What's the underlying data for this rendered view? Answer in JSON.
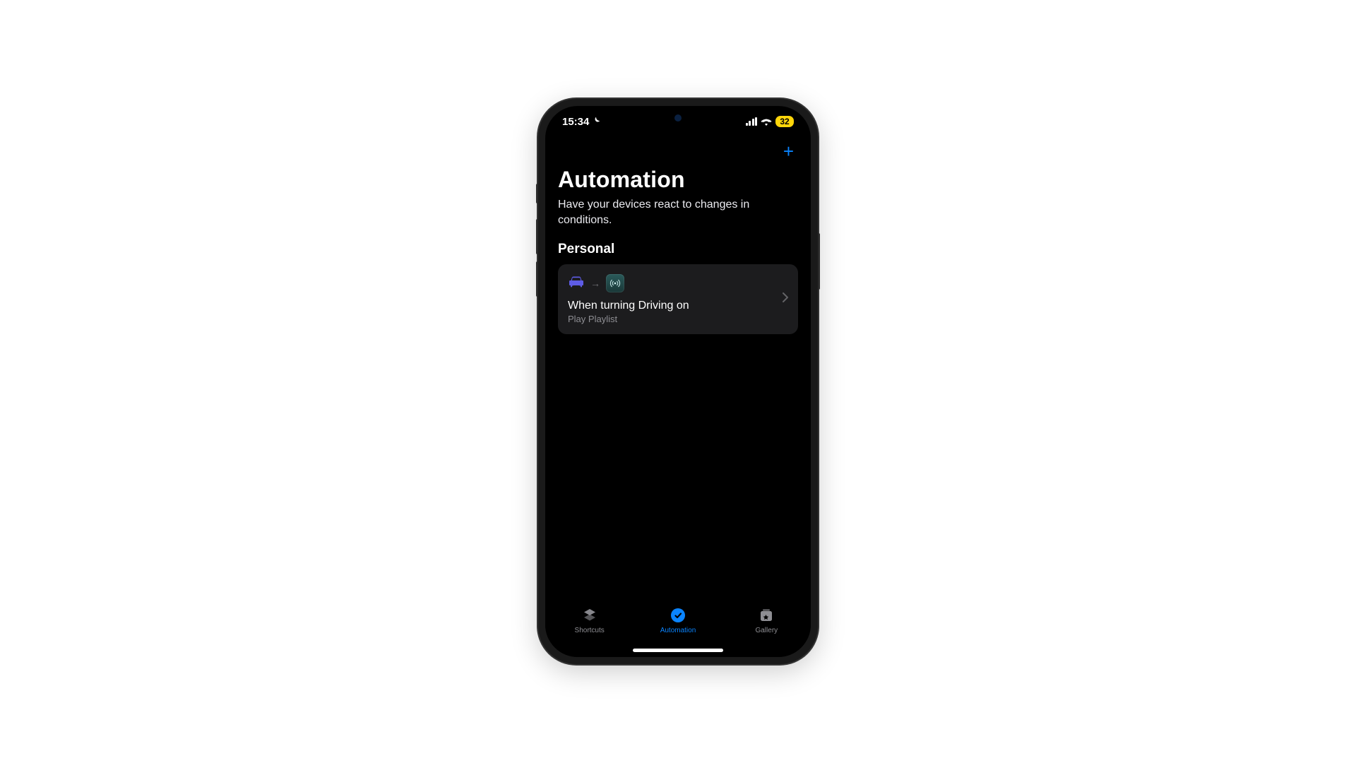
{
  "status": {
    "time": "15:34",
    "battery_level": "32"
  },
  "header": {
    "title": "Automation",
    "subtitle": "Have your devices react to changes in conditions."
  },
  "sections": [
    {
      "title": "Personal",
      "items": [
        {
          "title": "When turning Driving on",
          "subtitle": "Play Playlist"
        }
      ]
    }
  ],
  "tabs": {
    "items": [
      {
        "label": "Shortcuts",
        "active": false
      },
      {
        "label": "Automation",
        "active": true
      },
      {
        "label": "Gallery",
        "active": false
      }
    ]
  },
  "colors": {
    "accent": "#0a84ff",
    "battery_low": "#ffd60a",
    "card_bg": "#1c1c1e",
    "car_icon": "#5e5ce6"
  }
}
